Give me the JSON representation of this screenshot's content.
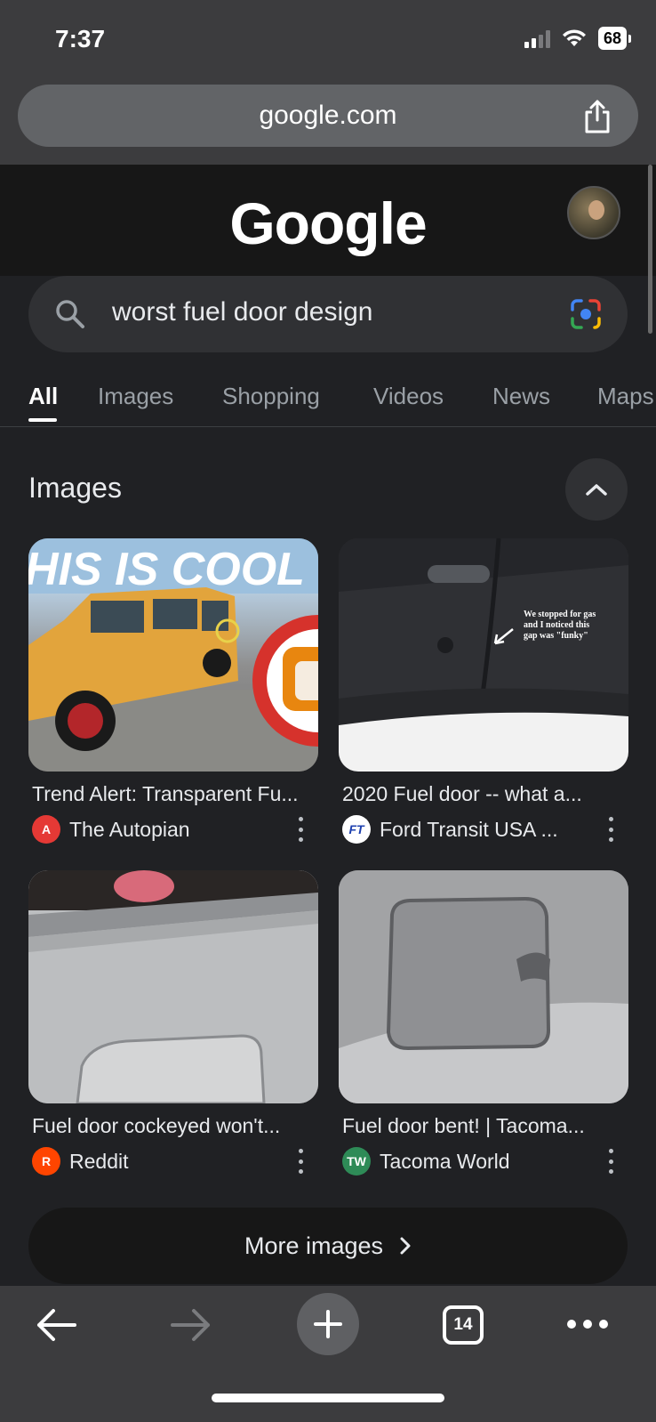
{
  "status_bar": {
    "time": "7:37",
    "battery": "68"
  },
  "url_bar": {
    "url": "google.com"
  },
  "header": {
    "logo": "Google"
  },
  "search": {
    "query": "worst fuel door design"
  },
  "tabs": [
    {
      "label": "All",
      "active": true
    },
    {
      "label": "Images"
    },
    {
      "label": "Shopping"
    },
    {
      "label": "Videos"
    },
    {
      "label": "News"
    },
    {
      "label": "Maps"
    }
  ],
  "images_section": {
    "title": "Images",
    "results": [
      {
        "title": "Trend Alert: Transparent Fu...",
        "source": "The Autopian",
        "favicon": "A",
        "favicon_color": "#e53935"
      },
      {
        "title": "2020 Fuel door -- what a...",
        "source": "Ford Transit USA ...",
        "favicon": "FT",
        "favicon_color": "#1e40af"
      },
      {
        "title": "Fuel door cockeyed won't...",
        "source": "Reddit",
        "favicon": "R",
        "favicon_color": "#ff4500"
      },
      {
        "title": "Fuel door bent! | Tacoma...",
        "source": "Tacoma World",
        "favicon": "TW",
        "favicon_color": "#2e8b57"
      }
    ],
    "thumb2_caption": "We stopped for gas\nand I noticed this\ngap was \"funky\"",
    "thumb1_overlay": "HIS IS COOL",
    "more_label": "More images"
  },
  "toolbar": {
    "tab_count": "14"
  },
  "colors": {
    "background": "#202124",
    "chrome": "#3c3c3e",
    "text": "#e8eaed",
    "muted": "#9aa0a6"
  }
}
